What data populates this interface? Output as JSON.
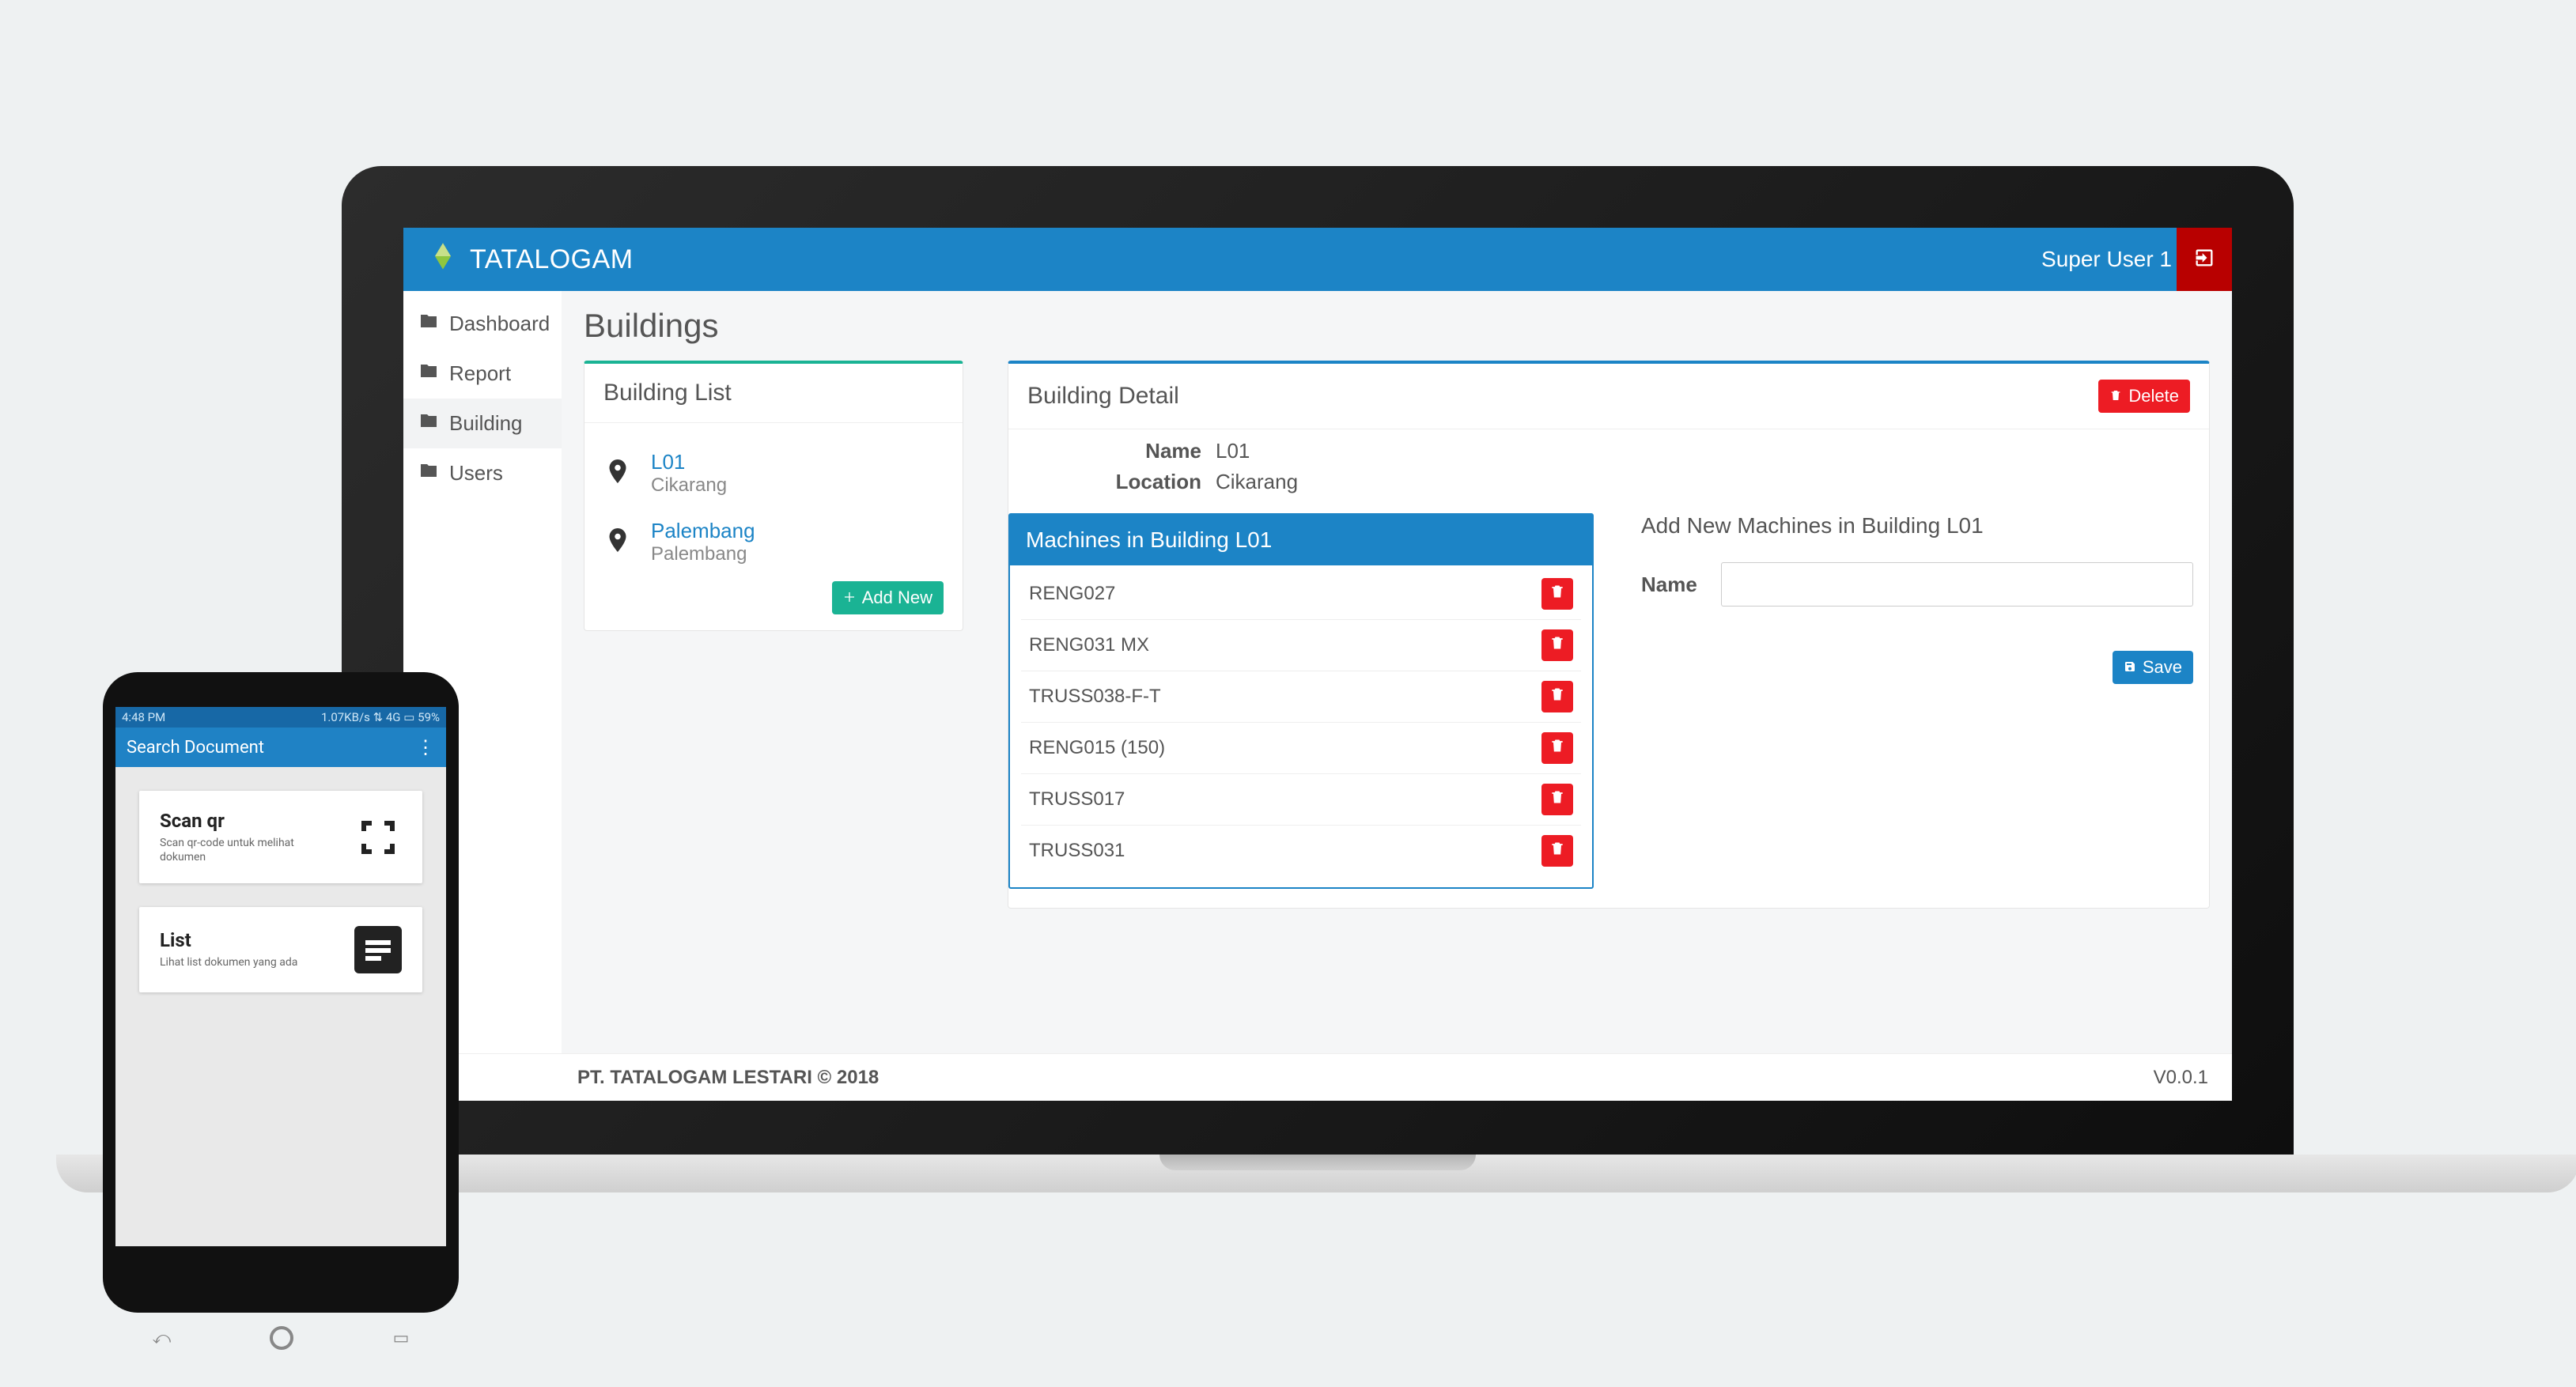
{
  "brand": "TATALOGAM",
  "user": "Super User 1",
  "sidebar": {
    "items": [
      {
        "label": "Dashboard"
      },
      {
        "label": "Report"
      },
      {
        "label": "Building"
      },
      {
        "label": "Users"
      }
    ]
  },
  "page": {
    "title": "Buildings"
  },
  "building_list": {
    "heading": "Building List",
    "items": [
      {
        "name": "L01",
        "location": "Cikarang"
      },
      {
        "name": "Palembang",
        "location": "Palembang"
      }
    ],
    "add_label": "Add New"
  },
  "building_detail": {
    "heading": "Building Detail",
    "delete_label": "Delete",
    "name_label": "Name",
    "name_value": "L01",
    "location_label": "Location",
    "location_value": "Cikarang",
    "machines_heading": "Machines in Building L01",
    "machines": [
      "RENG027",
      "RENG031 MX",
      "TRUSS038-F-T",
      "RENG015 (150)",
      "TRUSS017",
      "TRUSS031"
    ],
    "add_machine_heading": "Add New Machines in Building L01",
    "add_machine_name_label": "Name",
    "save_label": "Save"
  },
  "footer": {
    "left": "PT. TATALOGAM LESTARI © 2018",
    "right": "V0.0.1"
  },
  "mobile": {
    "status_time": "4:48 PM",
    "status_right": "1.07KB/s  ⇅  4G  ▭ 59%",
    "app_title": "Search Document",
    "card1_title": "Scan qr",
    "card1_sub": "Scan qr-code untuk melihat dokumen",
    "card2_title": "List",
    "card2_sub": "Lihat list dokumen yang ada"
  }
}
